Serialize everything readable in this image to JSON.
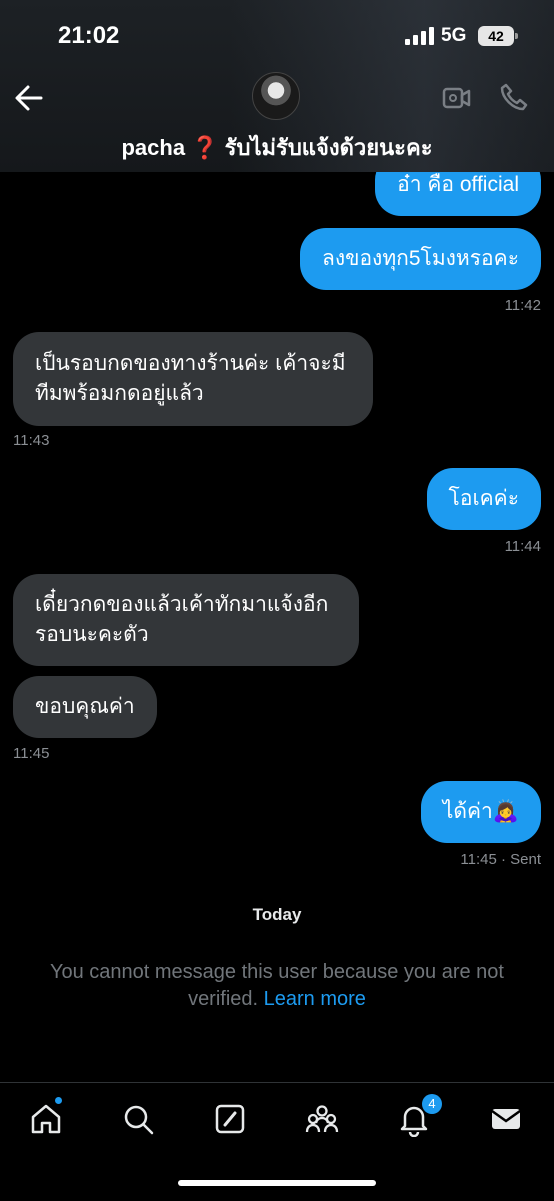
{
  "status": {
    "time": "21:02",
    "network": "5G",
    "battery": "42"
  },
  "header": {
    "title": "pacha ❓ รับไม่รับแจ้งด้วยนะคะ"
  },
  "messages": [
    {
      "text": "อ๋า คือ official",
      "dir": "out"
    },
    {
      "text": "ลงของทุก5โมงหรอคะ",
      "dir": "out",
      "time": "11:42"
    },
    {
      "text": "เป็นรอบกดของทางร้านค่ะ เค้าจะมีทีมพร้อมกดอยู่แล้ว",
      "dir": "in",
      "time": "11:43"
    },
    {
      "text": "โอเคค่ะ",
      "dir": "out",
      "time": "11:44"
    },
    {
      "text": "เดี๋ยวกดของแล้วเค้าทักมาแจ้งอีกรอบนะคะตัว",
      "dir": "in"
    },
    {
      "text": "ขอบคุณค่า",
      "dir": "in",
      "time": "11:45"
    },
    {
      "text": "ได้ค่า🙇‍♀️",
      "dir": "out",
      "time": "11:45 · Sent"
    }
  ],
  "thread": {
    "day_label": "Today",
    "notice": "You cannot message this user because you are not verified.",
    "learn_more": "Learn more"
  },
  "tabbar": {
    "items": [
      "home-icon",
      "search-icon",
      "compose-icon",
      "communities-icon",
      "notifications-icon",
      "messages-icon"
    ],
    "notification_count": "4"
  },
  "colors": {
    "accent": "#1d9bf0",
    "incoming": "#333639",
    "background": "#000000"
  }
}
